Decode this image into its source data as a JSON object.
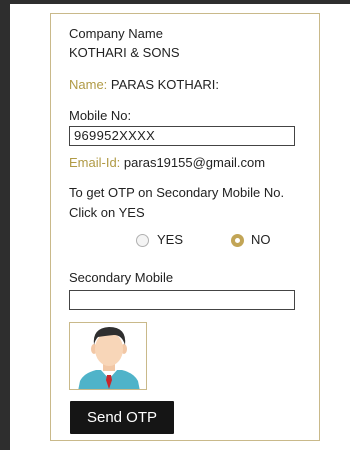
{
  "company": {
    "heading": "Company Name",
    "name": "KOTHARI & SONS"
  },
  "name_row": {
    "label": "Name:",
    "value": "PARAS KOTHARI:"
  },
  "mobile": {
    "label": "Mobile No:",
    "value": "969952XXXX"
  },
  "email": {
    "label": "Email-Id:",
    "value": "paras19155@gmail.com"
  },
  "otp_prompt": {
    "line1": "To get OTP on Secondary Mobile No.",
    "line2": "Click on YES"
  },
  "otp_choice": {
    "yes_label": "YES",
    "no_label": "NO",
    "selected": "NO"
  },
  "secondary": {
    "label": "Secondary Mobile",
    "value": ""
  },
  "avatar": {
    "icon": "user-avatar-icon"
  },
  "send_button": {
    "label": "Send OTP"
  },
  "colors": {
    "accent": "#c2a556",
    "label_gold": "#b09a45",
    "border": "#c9b98a",
    "button": "#151515"
  }
}
